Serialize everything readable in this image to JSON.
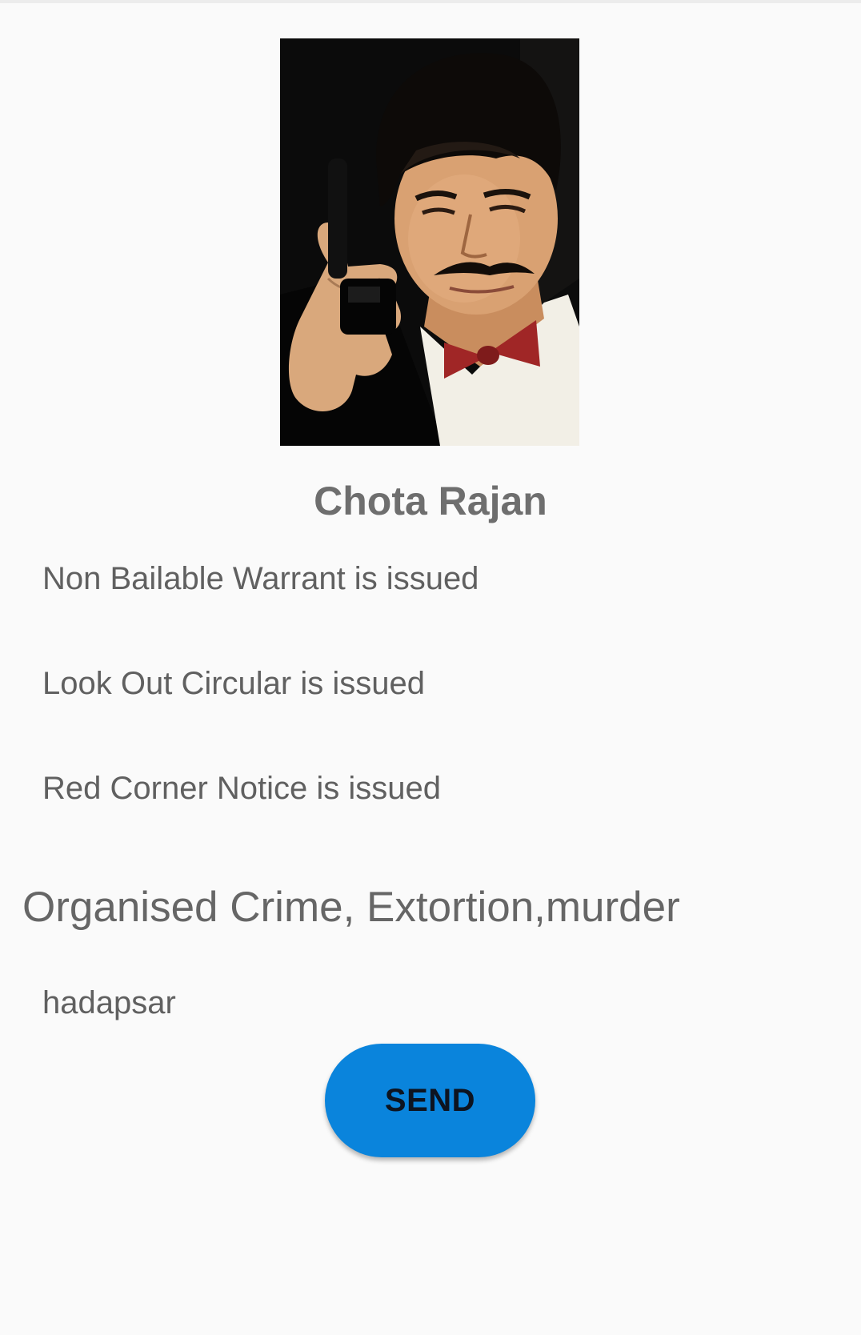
{
  "profile": {
    "photo_label": "photo",
    "name": "Chota Rajan"
  },
  "statuses": [
    "Non Bailable Warrant is issued",
    "Look Out Circular is issued",
    "Red Corner Notice is issued"
  ],
  "crimes": "Organised Crime, Extortion,murder",
  "location": "hadapsar",
  "actions": {
    "send_label": "SEND"
  },
  "colors": {
    "background": "#fafafa",
    "button": "#0a84dc",
    "text": "#606060"
  }
}
